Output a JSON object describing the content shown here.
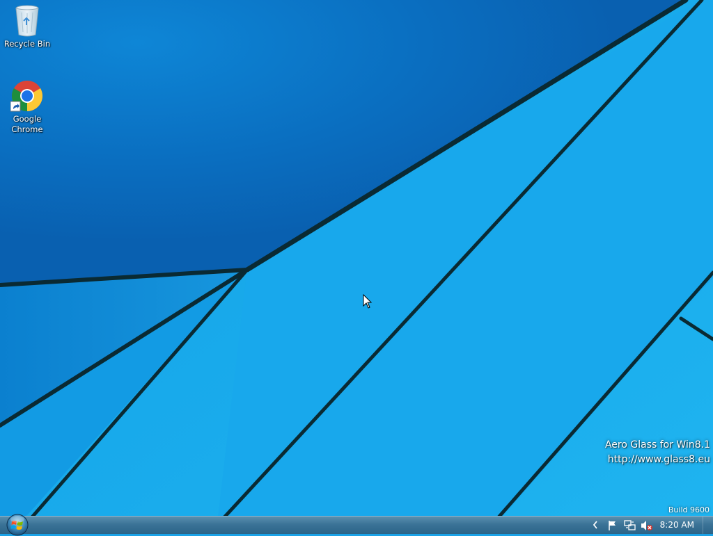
{
  "desktop": {
    "icons": [
      {
        "label": "Recycle Bin",
        "icon": "recycle-bin-icon"
      },
      {
        "label": "Google Chrome",
        "icon": "chrome-icon"
      }
    ]
  },
  "watermark": {
    "line1": "Aero Glass for Win8.1",
    "line2": "http://www.glass8.eu",
    "build": "Build 9600"
  },
  "taskbar": {
    "start_icon": "windows-start-orb-icon",
    "tray_icons": [
      "chevron-left-icon",
      "action-center-flag-icon",
      "network-icon",
      "volume-muted-icon"
    ],
    "clock": "8:20 AM"
  },
  "colors": {
    "wallpaper": "#1aa3e8",
    "wallpaper_dark": "#0b73c6",
    "wallpaper_lines": "#0a2a33",
    "taskbar": "#3b7397"
  }
}
